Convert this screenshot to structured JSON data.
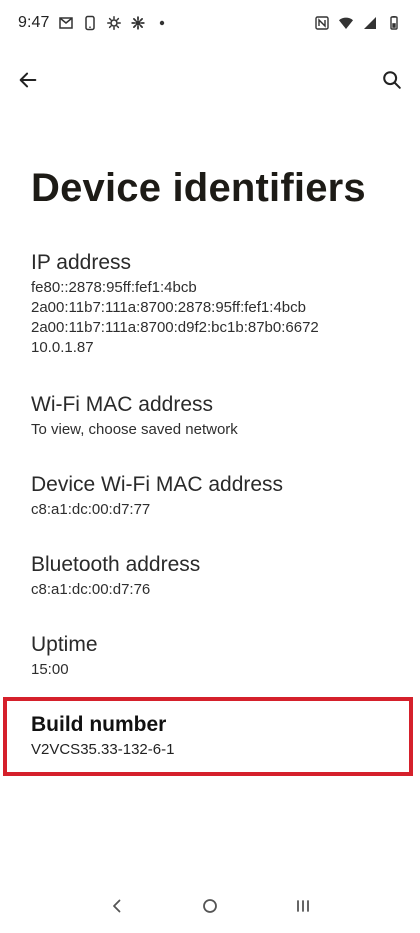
{
  "status_bar": {
    "time": "9:47",
    "left_icons": [
      "gmail-icon",
      "phone-mobile-icon",
      "settings-gear-icon",
      "settings-cog-icon",
      "notification-dot-icon"
    ],
    "right_icons": [
      "nfc-icon",
      "wifi-icon",
      "signal-icon",
      "battery-icon"
    ]
  },
  "app_bar": {
    "back_icon": "arrow-back-icon",
    "search_icon": "search-icon"
  },
  "page": {
    "title": "Device identifiers"
  },
  "items": {
    "ip": {
      "title": "IP address",
      "lines": [
        "fe80::2878:95ff:fef1:4bcb",
        "2a00:11b7:111a:8700:2878:95ff:fef1:4bcb",
        "2a00:11b7:111a:8700:d9f2:bc1b:87b0:6672",
        "10.0.1.87"
      ]
    },
    "wifi_mac": {
      "title": "Wi-Fi MAC address",
      "summary": "To view, choose saved network"
    },
    "device_wifi_mac": {
      "title": "Device Wi-Fi MAC address",
      "summary": "c8:a1:dc:00:d7:77"
    },
    "bluetooth": {
      "title": "Bluetooth address",
      "summary": "c8:a1:dc:00:d7:76"
    },
    "uptime": {
      "title": "Uptime",
      "summary": "15:00"
    },
    "build": {
      "title": "Build number",
      "summary": "V2VCS35.33-132-6-1"
    }
  },
  "nav_bar": {
    "back": "nav-back-icon",
    "home": "nav-home-icon",
    "recents": "nav-recents-icon"
  },
  "colors": {
    "highlight": "#d5202b",
    "text": "#1f1f1f",
    "background": "#ffffff"
  }
}
